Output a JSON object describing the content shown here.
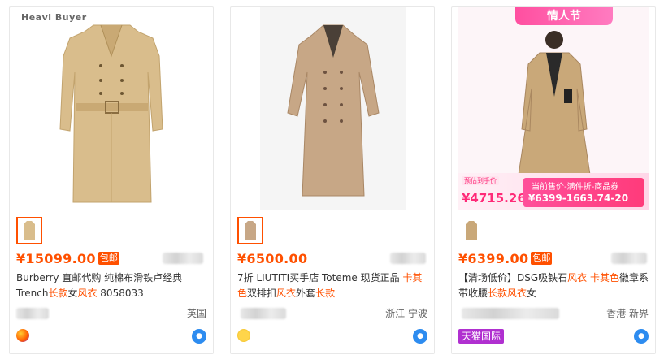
{
  "products": [
    {
      "watermark": "Heavi Buyer",
      "price": "¥15099.00",
      "badge": "包邮",
      "title_parts": [
        "Burberry 直邮代购 纯棉布滑铁卢经典Trench",
        "长款",
        "女",
        "风衣",
        " 8058033"
      ],
      "location": "英国"
    },
    {
      "price": "¥6500.00",
      "title_parts": [
        "7折 LIUTITI买手店 Toteme 现货正品 ",
        "卡其色",
        "双排扣",
        "风衣",
        "外套",
        "长款"
      ],
      "location": "浙江 宁波"
    },
    {
      "promo_top": "情人节",
      "promo_pre": "预估到手价",
      "promo_price": "¥4715.26",
      "promo_label": "当前售价-满件折-商品券",
      "promo_formula": "¥6399-1663.74-20",
      "price": "¥6399.00",
      "badge": "包邮",
      "title_parts": [
        "【清场低价】DSG吸铁石",
        "风衣",
        " ",
        "卡其色",
        "徽章系带收腰",
        "长款",
        "风衣",
        "女"
      ],
      "location": "香港 新界",
      "store_badge": "天猫国际"
    }
  ],
  "colors": {
    "accent": "#ff5000",
    "promo": "#ff3b7b"
  },
  "icons": [
    "coat-image",
    "wangwang-chat-icon",
    "shop-badge-icon"
  ]
}
